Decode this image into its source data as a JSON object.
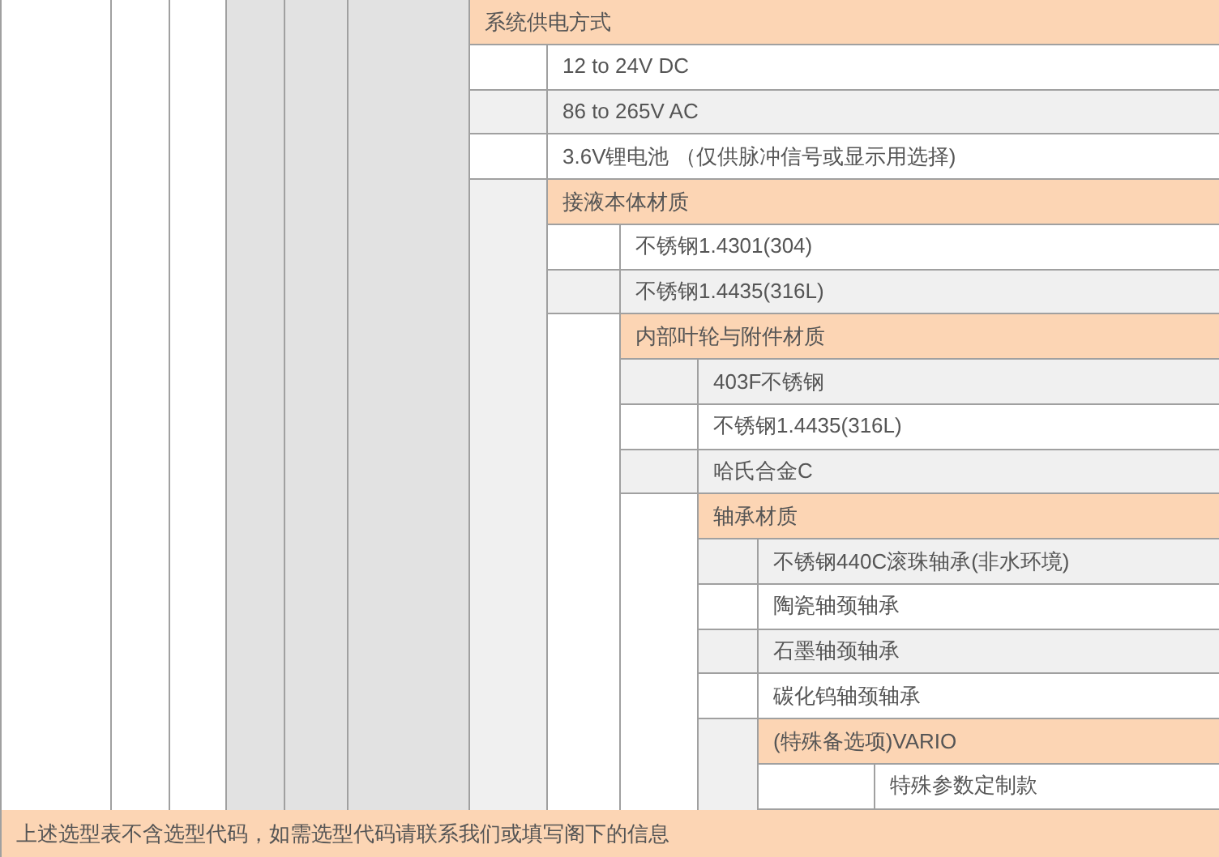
{
  "outer_columns": [
    {
      "shaded": false
    },
    {
      "shaded": false
    },
    {
      "shaded": false
    },
    {
      "shaded": true
    },
    {
      "shaded": true
    },
    {
      "shaded": true
    }
  ],
  "section": {
    "title": "系统供电方式",
    "options": [
      {
        "label": "12 to 24V DC",
        "shaded": false
      },
      {
        "label": "86 to 265V AC",
        "shaded": true
      },
      {
        "label": "3.6V锂电池 （仅供脉冲信号或显示用选择)",
        "shaded": false
      }
    ],
    "sub": {
      "indent_shaded": true,
      "title": "接液本体材质",
      "options": [
        {
          "label": "不锈钢1.4301(304)",
          "shaded": false
        },
        {
          "label": "不锈钢1.4435(316L)",
          "shaded": true
        }
      ],
      "sub": {
        "indent_shaded": false,
        "title": "内部叶轮与附件材质",
        "options": [
          {
            "label": "403F不锈钢",
            "shaded": true
          },
          {
            "label": "不锈钢1.4435(316L)",
            "shaded": false
          },
          {
            "label": "哈氏合金C",
            "shaded": true
          }
        ],
        "sub": {
          "indent_shaded": false,
          "title": "轴承材质",
          "options": [
            {
              "label": "不锈钢440C滚珠轴承(非水环境)",
              "shaded": true
            },
            {
              "label": "陶瓷轴颈轴承",
              "shaded": false
            },
            {
              "label": "石墨轴颈轴承",
              "shaded": true
            },
            {
              "label": "碳化钨轴颈轴承",
              "shaded": false
            }
          ],
          "sub": {
            "indent_shaded": true,
            "title": "(特殊备选项)VARIO",
            "options": [
              {
                "label": "特殊参数定制款",
                "shaded": false
              }
            ]
          }
        }
      }
    }
  },
  "footer": "上述选型表不含选型代码，如需选型代码请联系我们或填写阁下的信息"
}
